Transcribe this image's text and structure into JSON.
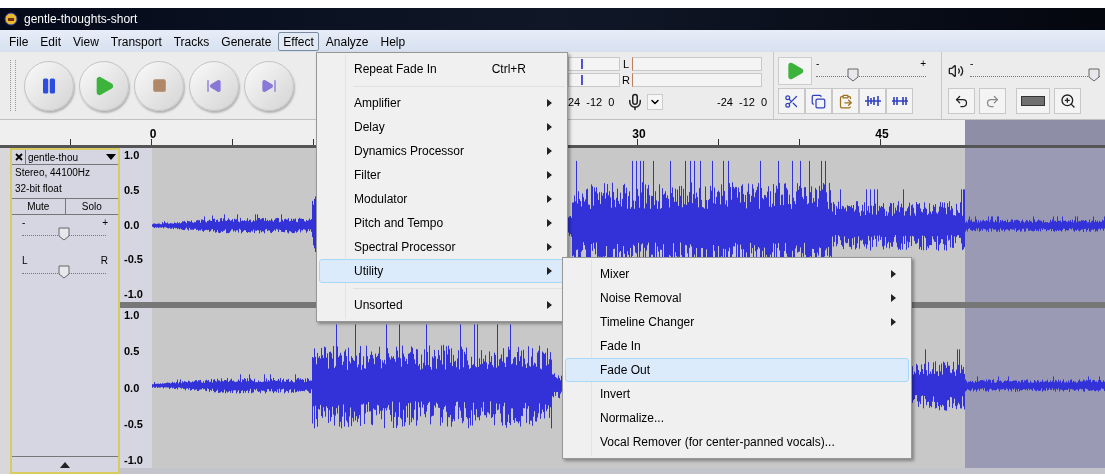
{
  "window": {
    "title": "gentle-thoughts-short"
  },
  "menu_bar": [
    {
      "label": "File",
      "selected": false
    },
    {
      "label": "Edit",
      "selected": false
    },
    {
      "label": "View",
      "selected": false
    },
    {
      "label": "Transport",
      "selected": false
    },
    {
      "label": "Tracks",
      "selected": false
    },
    {
      "label": "Generate",
      "selected": false
    },
    {
      "label": "Effect",
      "selected": true
    },
    {
      "label": "Analyze",
      "selected": false
    },
    {
      "label": "Help",
      "selected": false
    }
  ],
  "meter_toolbar": {
    "channel_labels": [
      "L",
      "R"
    ],
    "record_scale": [
      "24",
      "-12",
      "0"
    ],
    "playback_scale": [
      "-24",
      "-12",
      "0"
    ]
  },
  "speed_slider": {
    "minus": "-",
    "plus": "+",
    "level": 0.32
  },
  "volume_slider": {
    "minus": "-",
    "level": 1.0
  },
  "ruler": {
    "labels": [
      "0",
      "30",
      "45"
    ]
  },
  "track": {
    "name": "gentle-thou",
    "info": [
      "Stereo, 44100Hz",
      "32-bit float"
    ],
    "mute": "Mute",
    "solo": "Solo",
    "gain": {
      "minus": "-",
      "plus": "+",
      "level": 0.5
    },
    "pan": {
      "left": "L",
      "right": "R",
      "level": 0.5
    },
    "channels": [
      {
        "scale": [
          "1.0",
          "0.5",
          "0.0",
          "-0.5",
          "-1.0"
        ]
      },
      {
        "scale": [
          "1.0",
          "0.5",
          "0.0",
          "-0.5",
          "-1.0"
        ]
      }
    ]
  },
  "effect_menu": {
    "items": [
      {
        "kind": "command",
        "label": "Repeat Fade In",
        "shortcut": "Ctrl+R",
        "selected": false
      },
      {
        "kind": "separator"
      },
      {
        "kind": "submenu",
        "label": "Amplifier",
        "selected": false
      },
      {
        "kind": "submenu",
        "label": "Delay",
        "selected": false
      },
      {
        "kind": "submenu",
        "label": "Dynamics Processor",
        "selected": false
      },
      {
        "kind": "submenu",
        "label": "Filter",
        "selected": false
      },
      {
        "kind": "submenu",
        "label": "Modulator",
        "selected": false
      },
      {
        "kind": "submenu",
        "label": "Pitch and Tempo",
        "selected": false
      },
      {
        "kind": "submenu",
        "label": "Spectral Processor",
        "selected": false
      },
      {
        "kind": "submenu",
        "label": "Utility",
        "selected": true
      },
      {
        "kind": "separator"
      },
      {
        "kind": "submenu",
        "label": "Unsorted",
        "selected": false
      }
    ]
  },
  "utility_submenu": {
    "items": [
      {
        "kind": "submenu",
        "label": "Mixer",
        "selected": false
      },
      {
        "kind": "submenu",
        "label": "Noise Removal",
        "selected": false
      },
      {
        "kind": "submenu",
        "label": "Timeline Changer",
        "selected": false
      },
      {
        "kind": "command",
        "label": "Fade In",
        "selected": false
      },
      {
        "kind": "command",
        "label": "Fade Out",
        "selected": true
      },
      {
        "kind": "command",
        "label": "Invert",
        "selected": false
      },
      {
        "kind": "command",
        "label": "Normalize...",
        "selected": false
      },
      {
        "kind": "command",
        "label": "Vocal Remover (for center-panned vocals)...",
        "selected": false
      }
    ]
  }
}
